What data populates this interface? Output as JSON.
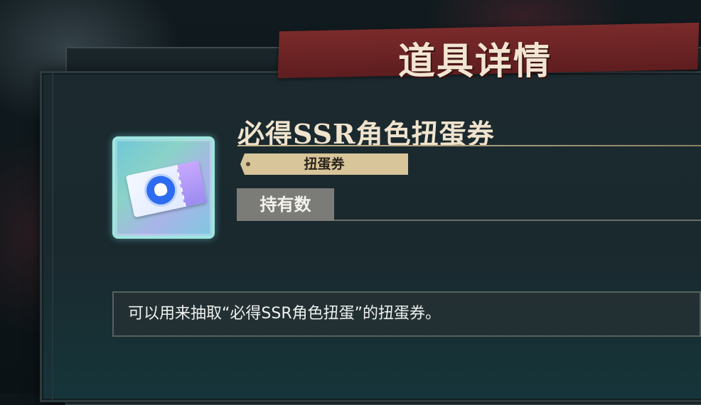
{
  "header": {
    "title": "道具详情"
  },
  "item": {
    "name": "必得SSR角色扭蛋券",
    "type_label": "扭蛋券",
    "owned_label": "持有数",
    "description": "可以用来抽取“必得SSR角色扭蛋”的扭蛋券。",
    "icon": "gacha-ticket-icon"
  },
  "colors": {
    "banner": "#6b2224",
    "title_text": "#f2e6d2",
    "tag_bg": "#d8c59a",
    "owned_bg": "#7b7b77",
    "panel_bg": "#1c2a2f"
  }
}
